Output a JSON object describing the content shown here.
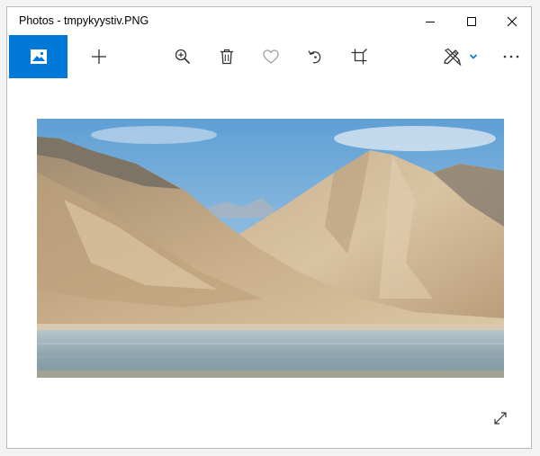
{
  "window": {
    "title": "Photos - tmpykyystiv.PNG"
  },
  "titlebar_buttons": {
    "minimize": "minimize-icon",
    "maximize": "maximize-icon",
    "close": "close-icon"
  },
  "toolbar": {
    "items": [
      {
        "name": "view-photo",
        "icon": "image-icon",
        "active": true
      },
      {
        "name": "add",
        "icon": "plus-icon"
      },
      {
        "name": "zoom",
        "icon": "zoom-in-icon"
      },
      {
        "name": "delete",
        "icon": "trash-icon"
      },
      {
        "name": "favorite",
        "icon": "heart-icon"
      },
      {
        "name": "rotate",
        "icon": "rotate-icon"
      },
      {
        "name": "crop",
        "icon": "crop-icon"
      },
      {
        "name": "edit-create",
        "icon": "edit-create-icon"
      },
      {
        "name": "more",
        "icon": "more-icon"
      }
    ]
  },
  "colors": {
    "accent": "#0078d7",
    "window_border": "#b9b9b9",
    "icon": "#333333"
  },
  "image": {
    "description_icon": "landscape-photo",
    "fullscreen_icon": "expand-icon"
  }
}
